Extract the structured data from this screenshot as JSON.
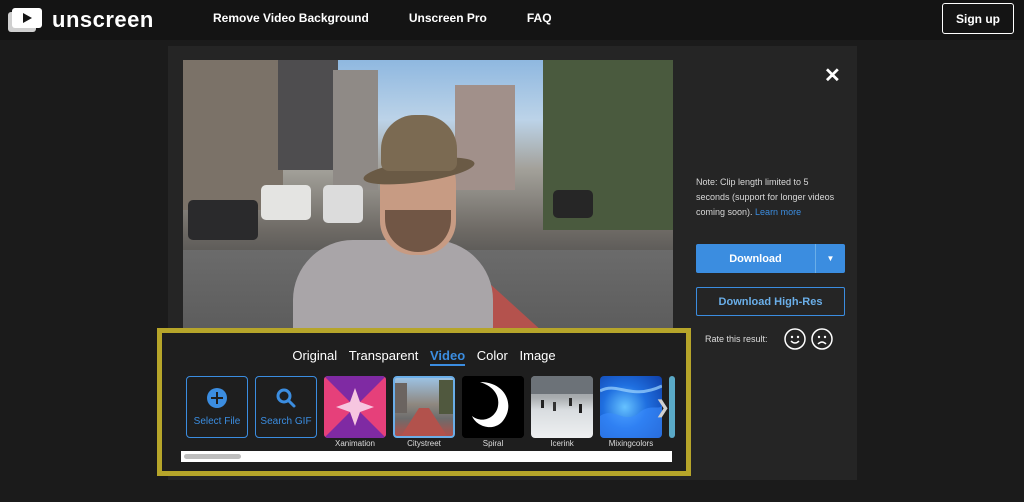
{
  "brand": {
    "name": "unscreen"
  },
  "nav": {
    "items": [
      "Remove Video Background",
      "Unscreen Pro",
      "FAQ"
    ],
    "signup_label": "Sign up"
  },
  "dialog": {
    "close_glyph": "✕"
  },
  "options": {
    "tabs": [
      {
        "label": "Original",
        "active": false
      },
      {
        "label": "Transparent",
        "active": false
      },
      {
        "label": "Video",
        "active": true
      },
      {
        "label": "Color",
        "active": false
      },
      {
        "label": "Image",
        "active": false
      }
    ],
    "select_file_label": "Select File",
    "search_gif_label": "Search GIF",
    "thumbnails": [
      {
        "label": "Xanimation"
      },
      {
        "label": "Citystreet",
        "selected": true
      },
      {
        "label": "Spiral"
      },
      {
        "label": "Icerink"
      },
      {
        "label": "Mixingcolors"
      }
    ]
  },
  "sidebar": {
    "note": "Note: Clip length limited to 5 seconds (support for longer videos coming soon).",
    "learn_more": "Learn more",
    "download_label": "Download",
    "download_hires_label": "Download High-Res",
    "rate_label": "Rate this result:"
  },
  "colors": {
    "accent": "#3b8de0",
    "highlight_border": "#b6a52a"
  }
}
